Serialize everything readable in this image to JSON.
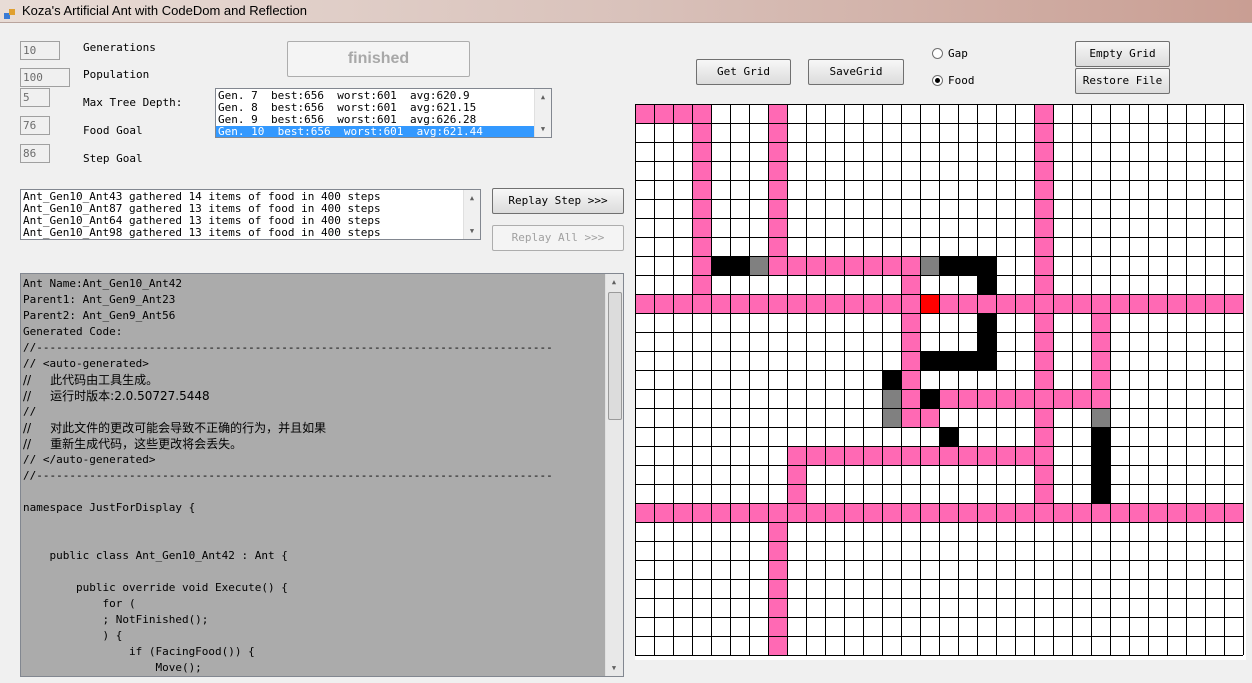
{
  "window": {
    "title": "Koza's Artificial Ant with CodeDom and Reflection"
  },
  "params": [
    {
      "value": "10",
      "label": "Generations"
    },
    {
      "value": "100",
      "label": "Population"
    },
    {
      "value": "5",
      "label": "Max Tree Depth:"
    },
    {
      "value": "76",
      "label": "Food Goal"
    },
    {
      "value": "86",
      "label": "Step Goal"
    }
  ],
  "status_button": "finished",
  "generations": [
    "Gen. 7  best:656  worst:601  avg:620.9",
    "Gen. 8  best:656  worst:601  avg:621.15",
    "Gen. 9  best:656  worst:601  avg:626.28",
    "Gen. 10  best:656  worst:601  avg:621.44"
  ],
  "ants": [
    "Ant_Gen10_Ant43 gathered 14 items of food in 400 steps",
    "Ant_Gen10_Ant87 gathered 13 items of food in 400 steps",
    "Ant_Gen10_Ant64 gathered 13 items of food in 400 steps",
    "Ant_Gen10_Ant98 gathered 13 items of food in 400 steps"
  ],
  "buttons": {
    "replay_step": "Replay Step >>>",
    "replay_all": "Replay All >>>",
    "get_grid": "Get Grid",
    "save_grid": "SaveGrid",
    "empty_grid": "Empty Grid",
    "restore_file": "Restore File"
  },
  "radios": {
    "gap": "Gap",
    "food": "Food",
    "selected": "Food"
  },
  "code_lines": [
    "Ant Name:Ant_Gen10_Ant42",
    "Parent1: Ant_Gen9_Ant23",
    "Parent2: Ant_Gen9_Ant56",
    "Generated Code:",
    "//------------------------------------------------------------------------------",
    "// <auto-generated>",
    "//     此代码由工具生成。",
    "//     运行时版本:2.0.50727.5448",
    "//",
    "//     对此文件的更改可能会导致不正确的行为，并且如果",
    "//     重新生成代码，这些更改将会丢失。",
    "// </auto-generated>",
    "//------------------------------------------------------------------------------",
    "",
    "namespace JustForDisplay {",
    "",
    "",
    "    public class Ant_Gen10_Ant42 : Ant {",
    "",
    "        public override void Execute() {",
    "            for (",
    "            ; NotFinished();",
    "            ) {",
    "                if (FacingFood()) {",
    "                    Move();"
  ],
  "grid_colors": {
    "line": "#000000",
    "trail": "#ff69b4",
    "food": "#000000",
    "visited": "#808080",
    "ant": "#ff0000",
    "empty": "#ffffff"
  }
}
